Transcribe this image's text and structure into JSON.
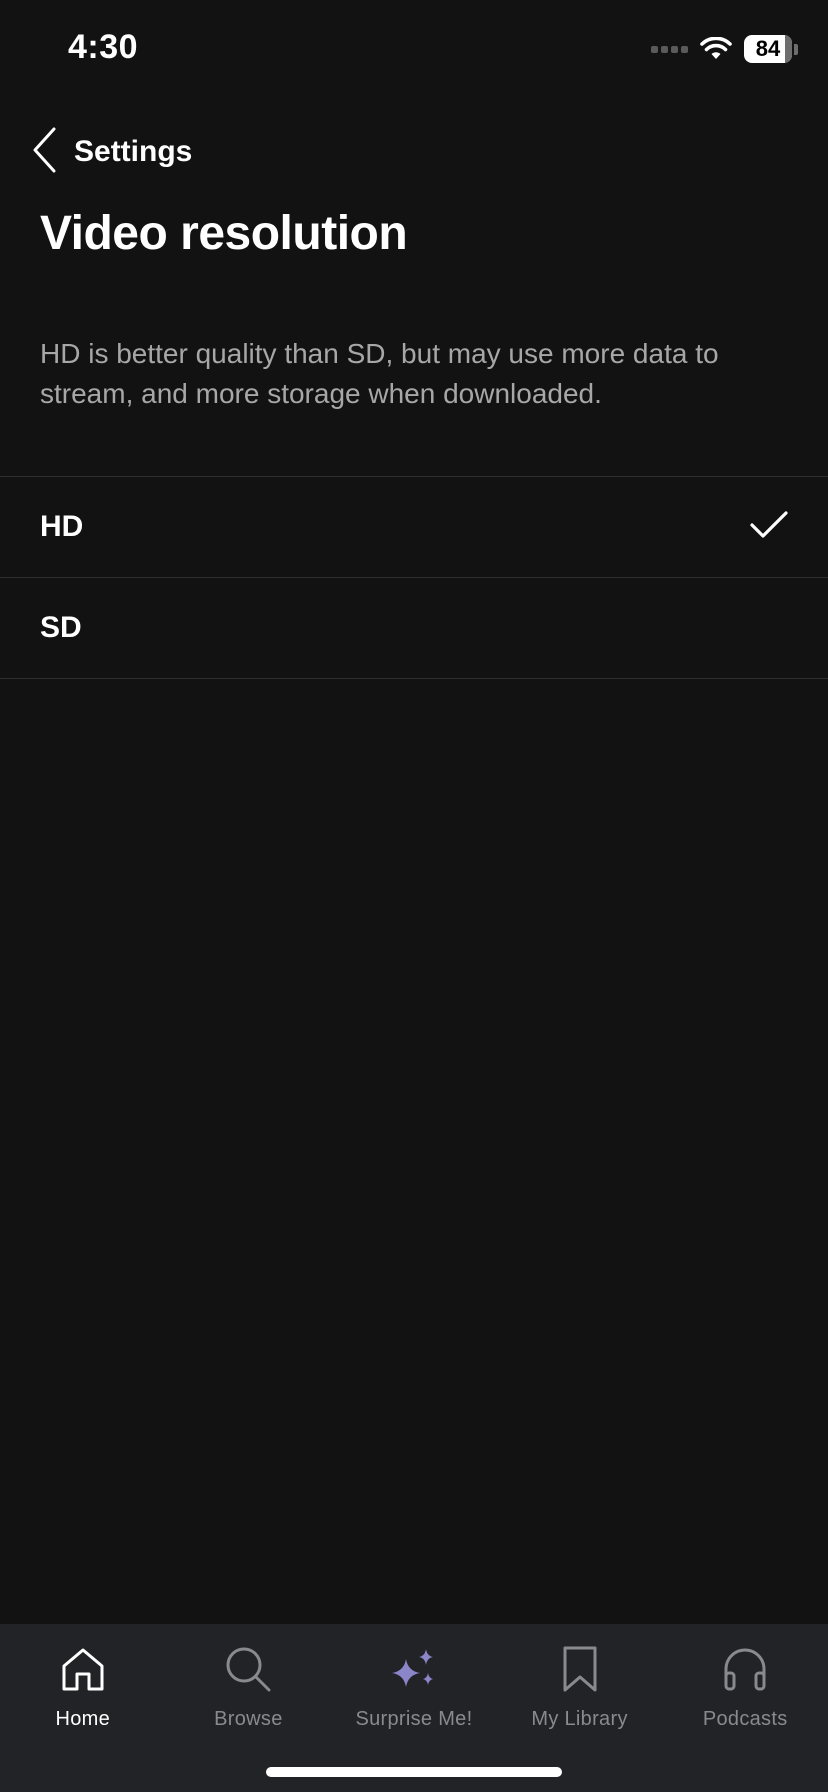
{
  "status_bar": {
    "time": "4:30",
    "battery": "84"
  },
  "header": {
    "back_label": "Settings",
    "title": "Video resolution",
    "description": "HD is better quality than SD, but may use more data to stream, and more storage when downloaded."
  },
  "options": [
    {
      "label": "HD",
      "selected": true
    },
    {
      "label": "SD",
      "selected": false
    }
  ],
  "tab_bar": {
    "tabs": [
      {
        "label": "Home",
        "icon": "home-icon",
        "active": true
      },
      {
        "label": "Browse",
        "icon": "search-icon",
        "active": false
      },
      {
        "label": "Surprise Me!",
        "icon": "sparkle-icon",
        "active": false
      },
      {
        "label": "My Library",
        "icon": "bookmark-icon",
        "active": false
      },
      {
        "label": "Podcasts",
        "icon": "headphones-icon",
        "active": false
      }
    ]
  },
  "colors": {
    "background": "#121212",
    "tab_bar_background": "#212327",
    "divider": "#2e2e2e",
    "secondary_text": "#a7a7a7",
    "inactive_tab": "#8a8a8e",
    "sparkle_accent": "#8b85c9"
  }
}
